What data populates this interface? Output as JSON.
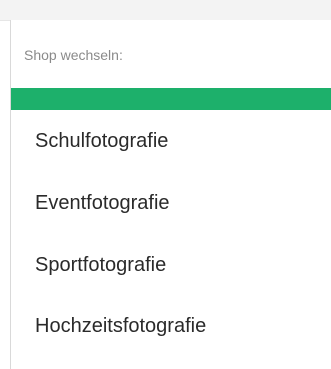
{
  "menu": {
    "header": "Shop wechseln:",
    "accent_color": "#1db06b",
    "items": [
      {
        "label": "Schulfotografie"
      },
      {
        "label": "Eventfotografie"
      },
      {
        "label": "Sportfotografie"
      },
      {
        "label": "Hochzeitsfotografie"
      }
    ]
  }
}
